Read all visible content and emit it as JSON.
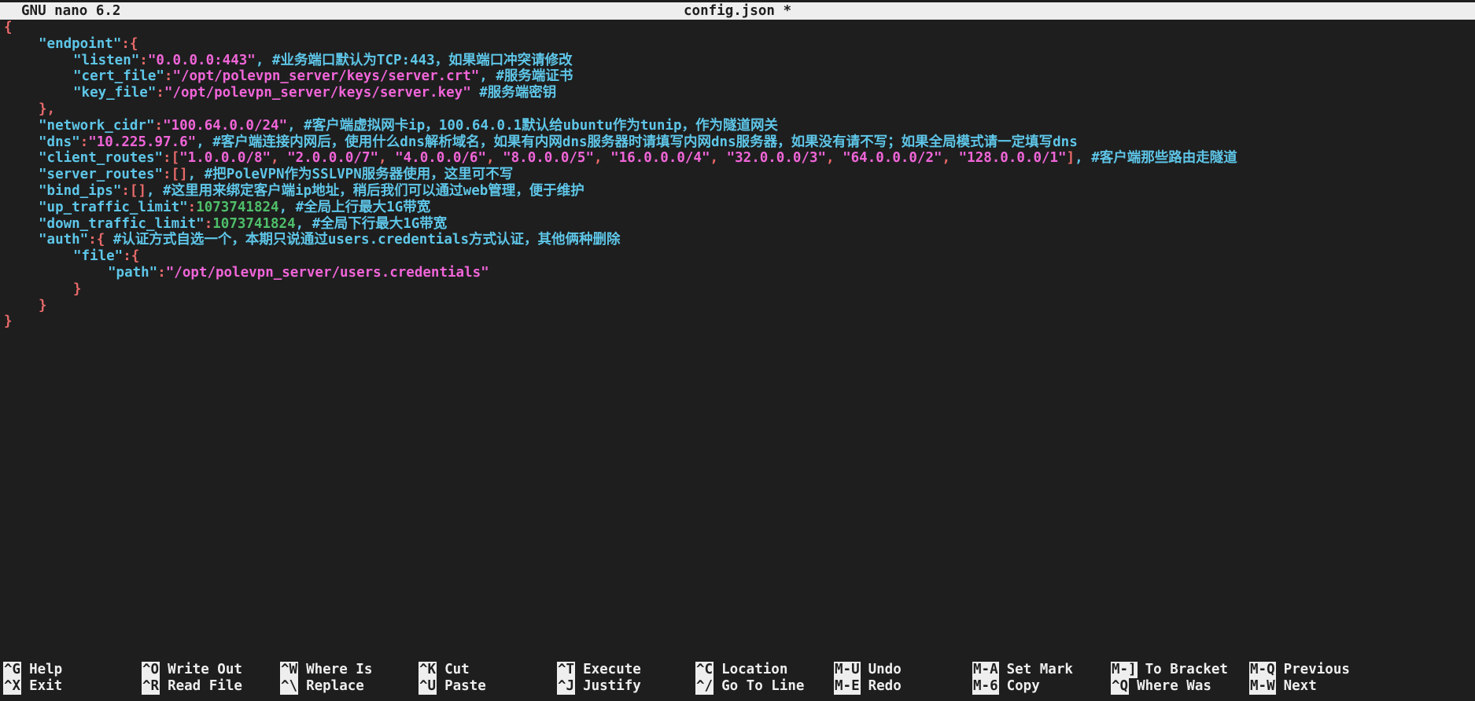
{
  "titlebar": {
    "app": "GNU nano 6.2",
    "file": "config.json *"
  },
  "editor": {
    "l0": {
      "brace": "{"
    },
    "l1": {
      "key": "\"endpoint\"",
      "colon": ":",
      "brace": "{"
    },
    "l2": {
      "key": "\"listen\"",
      "colon": ":",
      "val": "\"0.0.0.0:443\"",
      "comment": ", #业务端口默认为TCP:443，如果端口冲突请修改"
    },
    "l3": {
      "key": "\"cert_file\"",
      "colon": ":",
      "val": "\"/opt/polevpn_server/keys/server.crt\"",
      "comment": ", #服务端证书"
    },
    "l4": {
      "key": "\"key_file\"",
      "colon": ":",
      "val": "\"/opt/polevpn_server/keys/server.key\"",
      "comment": " #服务端密钥"
    },
    "l5": {
      "brace": "},"
    },
    "l6": {
      "key": "\"network_cidr\"",
      "colon": ":",
      "val": "\"100.64.0.0/24\"",
      "comment": ", #客户端虚拟网卡ip，100.64.0.1默认给ubuntu作为tunip，作为隧道网关"
    },
    "l7": {
      "key": "\"dns\"",
      "colon": ":",
      "val": "\"10.225.97.6\"",
      "comment": ", #客户端连接内网后，使用什么dns解析域名，如果有内网dns服务器时请填写内网dns服务器，如果没有请不写；如果全局模式请一定填写dns"
    },
    "l8": {
      "key": "\"client_routes\"",
      "colon": ":",
      "open": "[",
      "routes": [
        "\"1.0.0.0/8\"",
        "\"2.0.0.0/7\"",
        "\"4.0.0.0/6\"",
        "\"8.0.0.0/5\"",
        "\"16.0.0.0/4\"",
        "\"32.0.0.0/3\"",
        "\"64.0.0.0/2\"",
        "\"128.0.0.0/1\""
      ],
      "sep": ", ",
      "close": "]",
      "comment": ", #客户端那些路由走隧道"
    },
    "l9": {
      "key": "\"server_routes\"",
      "colon": ":",
      "val": "[]",
      "comment": ", #把PoleVPN作为SSLVPN服务器使用，这里可不写"
    },
    "l10": {
      "key": "\"bind_ips\"",
      "colon": ":",
      "val": "[]",
      "comment": ", #这里用来绑定客户端ip地址，稍后我们可以通过web管理，便于维护"
    },
    "l11": {
      "key": "\"up_traffic_limit\"",
      "colon": ":",
      "num": "1073741824",
      "comment": ", #全局上行最大1G带宽"
    },
    "l12": {
      "key": "\"down_traffic_limit\"",
      "colon": ":",
      "num": "1073741824",
      "comment": ", #全局下行最大1G带宽"
    },
    "l13": {
      "key": "\"auth\"",
      "colon": ":",
      "brace": "{",
      "comment": " #认证方式自选一个，本期只说通过users.credentials方式认证，其他俩种删除"
    },
    "l14": {
      "key": "\"file\"",
      "colon": ":",
      "brace": "{"
    },
    "l15": {
      "key": "\"path\"",
      "colon": ":",
      "val": "\"/opt/polevpn_server/users.credentials\""
    },
    "l16": {
      "brace": "}"
    },
    "l17": {
      "brace": "}"
    },
    "l18": {
      "brace": "}"
    }
  },
  "shortcuts": [
    {
      "key": "^G",
      "label": "Help"
    },
    {
      "key": "^X",
      "label": "Exit"
    },
    {
      "key": "^O",
      "label": "Write Out"
    },
    {
      "key": "^R",
      "label": "Read File"
    },
    {
      "key": "^W",
      "label": "Where Is"
    },
    {
      "key": "^\\",
      "label": "Replace"
    },
    {
      "key": "^K",
      "label": "Cut"
    },
    {
      "key": "^U",
      "label": "Paste"
    },
    {
      "key": "^T",
      "label": "Execute"
    },
    {
      "key": "^J",
      "label": "Justify"
    },
    {
      "key": "^C",
      "label": "Location"
    },
    {
      "key": "^/",
      "label": "Go To Line"
    },
    {
      "key": "M-U",
      "label": "Undo"
    },
    {
      "key": "M-E",
      "label": "Redo"
    },
    {
      "key": "M-A",
      "label": "Set Mark"
    },
    {
      "key": "M-6",
      "label": "Copy"
    },
    {
      "key": "M-]",
      "label": "To Bracket"
    },
    {
      "key": "^Q",
      "label": "Where Was"
    },
    {
      "key": "M-Q",
      "label": "Previous"
    },
    {
      "key": "M-W",
      "label": "Next"
    }
  ],
  "colors": {
    "background": "#1e1e1e",
    "key": "#5ec6e8",
    "string": "#f065d8",
    "punct": "#e96a6a",
    "number": "#4fbf6a",
    "bar": "#eeeeee"
  }
}
